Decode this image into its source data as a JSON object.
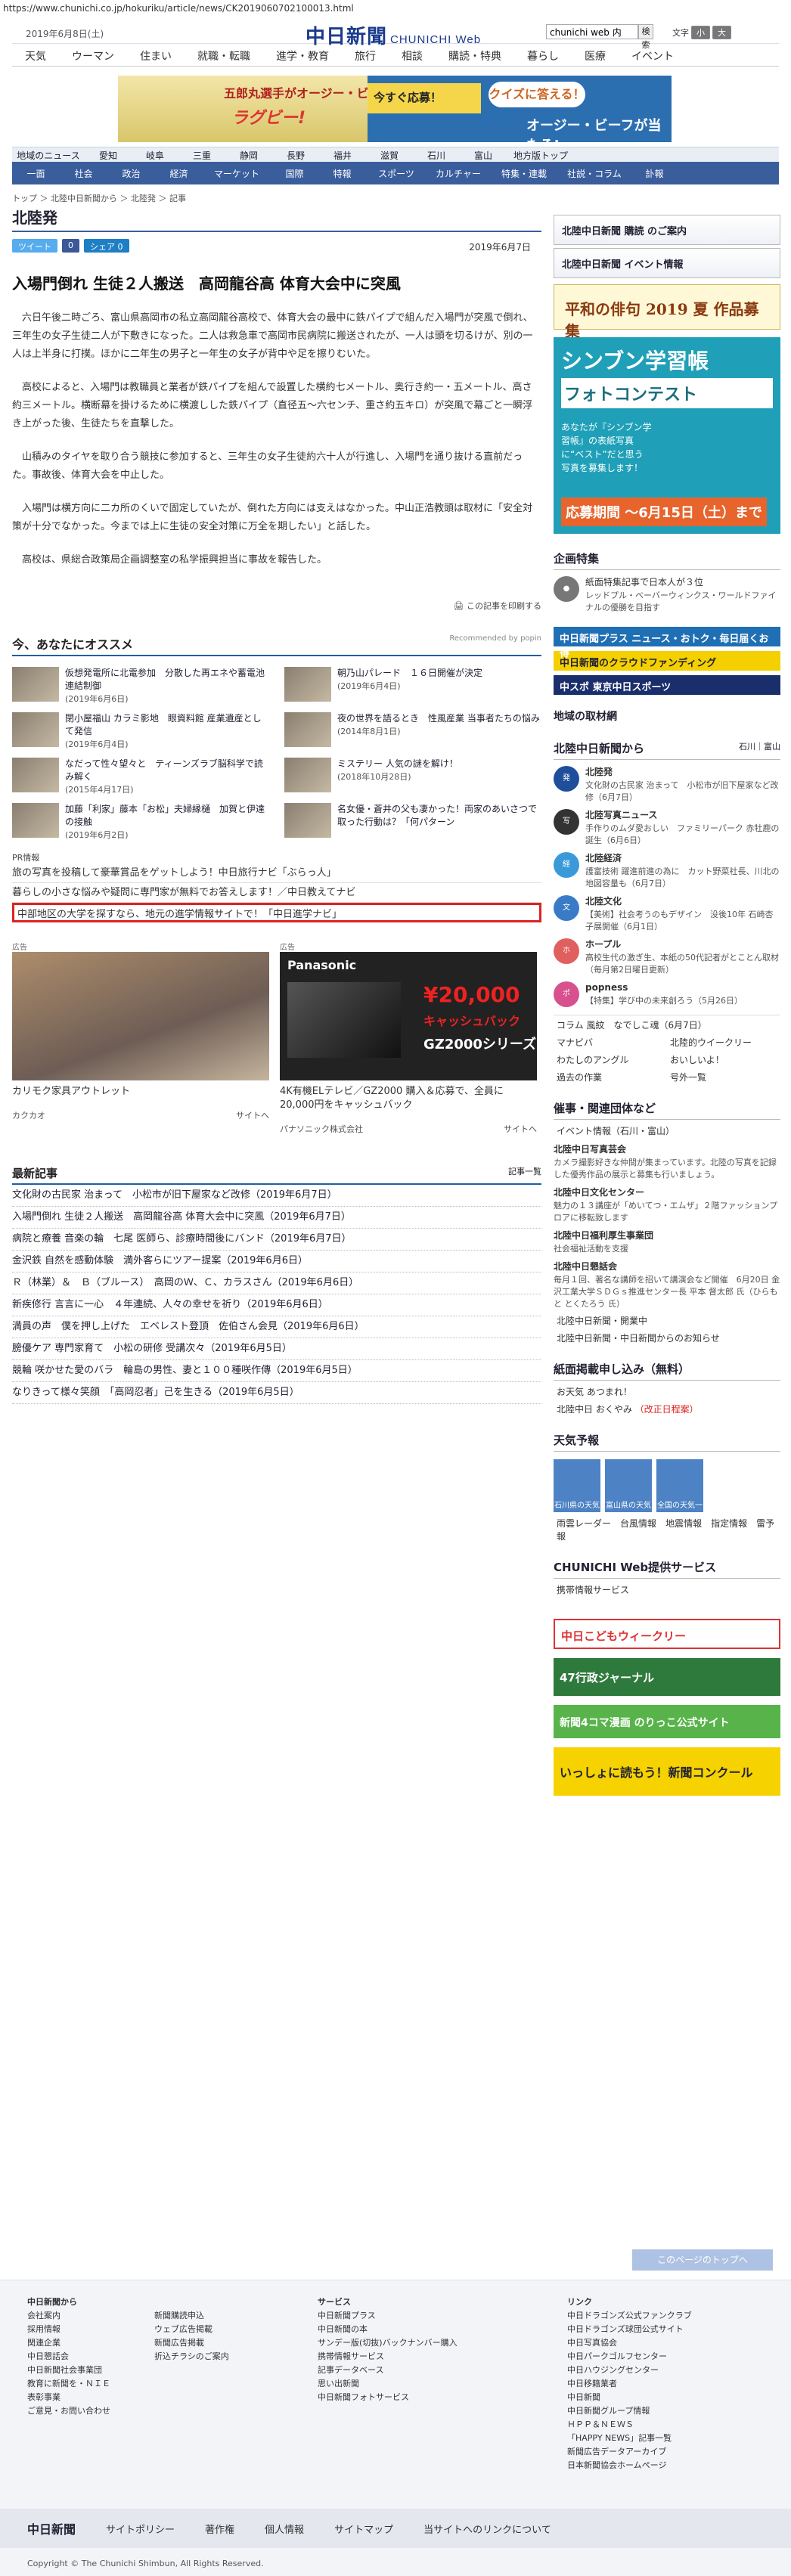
{
  "url": "https://www.chunichi.co.jp/hokuriku/article/news/CK2019060702100013.html",
  "header": {
    "date": "2019年6月8日(土)",
    "logo": "中日新聞",
    "logo_sub": "CHUNICHI Web",
    "search_value": "chunichi web 内",
    "search_btn": "検索",
    "font_label": "文字",
    "font_small": "小",
    "font_large": "大"
  },
  "nav1": [
    "天気",
    "ウーマン",
    "住まい",
    "就職・転職",
    "進学・教育",
    "旅行",
    "相談",
    "購読・特典",
    "暮らし",
    "医療",
    "イベント"
  ],
  "ad_top": {
    "t1": "五郎丸選手がオージー・ビーフ",
    "t2": "ラグビー!",
    "bubble": "クイズに答える！",
    "r1": "今すぐ応募！",
    "r2": "オージー・ビーフが当たる!"
  },
  "nav2": [
    "地域のニュース",
    "愛知",
    "岐阜",
    "三重",
    "静岡",
    "長野",
    "福井",
    "滋賀",
    "石川",
    "富山",
    "地方版トップ"
  ],
  "nav3": [
    "一面",
    "社会",
    "政治",
    "経済",
    "マーケット",
    "国際",
    "特報",
    "スポーツ",
    "カルチャー",
    "特集・連載",
    "社説・コラム",
    "訃報"
  ],
  "breadcrumb": "トップ ＞ 北陸中日新聞から ＞ 北陸発 ＞ 記事",
  "article": {
    "section": "北陸発",
    "share_tweet": "ツイート",
    "share_fb": "0",
    "share_hb": "シェア 0",
    "pub_date": "2019年6月7日",
    "headline": "入場門倒れ 生徒２人搬送　高岡龍谷高 体育大会中に突風",
    "paragraphs": [
      "六日午後二時ごろ、富山県高岡市の私立高岡龍谷高校で、体育大会の最中に鉄パイプで組んだ入場門が突風で倒れ、三年生の女子生徒二人が下敷きになった。二人は救急車で高岡市民病院に搬送されたが、一人は頭を切るけが、別の一人は上半身に打撲。ほかに二年生の男子と一年生の女子が背中や足を擦りむいた。",
      "高校によると、入場門は教職員と業者が鉄パイプを組んで設置した横約七メートル、奥行き約一・五メートル、高さ約三メートル。横断幕を掛けるために横渡しした鉄パイプ（直径五〜六センチ、重さ約五キロ）が突風で幕ごと一瞬浮き上がった後、生徒たちを直撃した。",
      "山積みのタイヤを取り合う競技に参加すると、三年生の女子生徒約六十人が行進し、入場門を通り抜ける直前だった。事故後、体育大会を中止した。",
      "入場門は横方向に二カ所のくいで固定していたが、倒れた方向には支えはなかった。中山正浩教頭は取材に「安全対策が十分でなかった。今までは上に生徒の安全対策に万全を期したい」と話した。",
      "高校は、県総合政策局企画調整室の私学振興担当に事故を報告した。"
    ],
    "print_label": "この記事を印刷する"
  },
  "recommend": {
    "title": "今、あなたにオススメ",
    "popin": "Recommended by popin",
    "items": [
      {
        "t": "仮想発電所に北電参加　分散した再エネや蓄電池連結制御",
        "d": "(2019年6月6日)"
      },
      {
        "t": "朝乃山パレード　１６日開催が決定",
        "d": "(2019年6月4日)"
      },
      {
        "t": "閉小屋福山 カラミ影地　眼資料館 産業遺産として発信",
        "d": "(2019年6月4日)"
      },
      {
        "t": "夜の世界を語るとき　性風産業 当事者たちの悩み",
        "d": "(2014年8月1日)"
      },
      {
        "t": "なだって性々望々と　ティーンズラブ脳科学で読み解く",
        "d": "(2015年4月17日)"
      },
      {
        "t": "ミステリー 人気の謎を解け！",
        "d": "(2018年10月28日)"
      },
      {
        "t": "加藤「利家」藤本「お松」夫婦縁樋　加賀と伊達の接触",
        "d": "(2019年6月2日)"
      },
      {
        "t": "名女優・蒼井の父も凄かった！両家のあいさつで取った行動は？「何パターン",
        "d": ""
      }
    ]
  },
  "pr": {
    "label": "PR情報",
    "items": [
      "旅の写真を投稿して豪華賞品をゲットしよう！中日旅行ナビ「ぶらっ人」",
      "暮らしの小さな悩みや疑問に専門家が無料でお答えします！／中日教えてナビ",
      "中部地区の大学を探すなら、地元の進学情報サイトで！「中日進学ナビ」"
    ]
  },
  "ads": [
    {
      "label": "広告",
      "caption": "カリモク家具アウトレット",
      "src": "カクカオ",
      "site": "サイトへ"
    },
    {
      "label": "広告",
      "brand": "Panasonic",
      "price": "¥20,000",
      "cashback": "キャッシュバック",
      "model": "GZ2000シリーズ",
      "caption": "4K有機ELテレビ／GZ2000 購入＆応募で、全員に20,000円をキャッシュバック",
      "src": "パナソニック株式会社",
      "site": "サイトへ"
    }
  ],
  "latest": {
    "title": "最新記事",
    "more": "記事一覧",
    "items": [
      "文化財の古民家 治まって　小松市が旧下屋家など改修（2019年6月7日）",
      "入場門倒れ 生徒２人搬送　高岡龍谷高 体育大会中に突風（2019年6月7日）",
      "病院と療養 音楽の輪　七尾 医師ら、診療時間後にバンド（2019年6月7日）",
      "金沢鉄 自然を感動体験　満外客らにツアー提案（2019年6月6日）",
      "Ｒ（林業）＆　Ｂ（ブルース）　高岡のＷ、Ｃ、カラスさん（2019年6月6日）",
      "新疾修行 言言に一心　４年連続、人々の幸せを祈り（2019年6月6日）",
      "満員の声　僕を押し上げた　エベレスト登頂　佐伯さん会見（2019年6月6日）",
      "膀優ケア 専門家育て　小松の研修 受講次々（2019年6月5日）",
      "競輪 咲かせた愛のバラ　輪島の男性、妻と１００種咲作傳（2019年6月5日）",
      "なりきって様々笑顔　「高岡忍者」己を生きる（2019年6月5日）"
    ]
  },
  "side": {
    "btn1": "北陸中日新聞 購読 のご案内",
    "btn2": "北陸中日新聞 イベント情報",
    "haiku": "平和の俳句 2019 夏 作品募集",
    "contest": {
      "h": "シンブン学習帳",
      "p": "フォトコンテスト",
      "q": "あなたが『シンブン学習帳』の表紙写真に“ベスト”だと思う写真を募集します！",
      "e": "応募期間 〜6月15日（土）まで"
    },
    "corp_title": "企画特集",
    "corp_items": [
      {
        "t": "紙面特集記事で日本人が３位",
        "n": "レッドプル・ベーバーウィンクス・ワールドファイナルの優勝を目指す"
      }
    ],
    "bar1": "中日新聞プラス ニュース・おトク・毎日届くお得",
    "bar2": "中日新聞のクラウドファンディング",
    "bar3": "中スポ 東京中日スポーツ",
    "region": "地域の取材網",
    "from_title": "北陸中日新聞から",
    "from_tabs": "石川｜富山",
    "from_items": [
      {
        "i": "発",
        "t": "北陸発",
        "n": "文化財の古民家 治まって　小松市が旧下屋家など改修（6月7日）"
      },
      {
        "i": "写",
        "t": "北陸写真ニュース",
        "n": "手作りのムダ愛おしい　ファミリーパーク 赤牡鹿の誕生（6月6日）"
      },
      {
        "i": "経",
        "t": "北陸経済",
        "n": "護富技術 躍進前進の為に　カット野菜社長、川北の地図容量も（6月7日）"
      },
      {
        "i": "文",
        "t": "北陸文化",
        "n": "【美術】社会考うのもデザイン　没後10年 石崎杏子展開催（6月1日）"
      },
      {
        "i": "ホ",
        "t": "ホープル",
        "n": "高校生代の激ぎ生、本紙の50代記者がとことん取材（毎月第2日曜日更新）"
      },
      {
        "i": "ポ",
        "t": "popness",
        "n": "【特集】学び中の未来創ろう（5月26日）"
      }
    ],
    "column": "コラム 風紋　なでしこ魂（6月7日）",
    "link_pairs": [
      [
        "マナビバ",
        "北陸的ウイークリー"
      ],
      [
        "わたしのアングル",
        "おいしいよ！"
      ],
      [
        "過去の作業",
        "号外一覧"
      ]
    ],
    "event_title": "催事・関連団体など",
    "event_sub": "イベント情報（石川・富山）",
    "events": [
      {
        "t": "北陸中日写真芸会",
        "n": "カメラ撮影好きな仲間が集まっています。北陸の写真を記録した優秀作品の展示と募集も行いましょう。"
      },
      {
        "t": "北陸中日文化センター",
        "n": "魅力の１３講座が「めいてつ・エムザ」２階ファッションプロアに移転致します"
      },
      {
        "t": "北陸中日福利厚生事業団",
        "n": "社会福祉活動を支援"
      },
      {
        "t": "北陸中日懇話会",
        "n": "毎月１回、著名な講師を招いて講演会など開催　6月20日 金沢工業大学ＳＤＧｓ推進センター長 平本 督太郎 氏（ひらもと とくたろう 氏）"
      }
    ],
    "ev_links": [
      "北陸中日新聞・開業中",
      "北陸中日新聞・中日新聞からのお知らせ"
    ],
    "notice_title": "紙面掲載申し込み（無料）",
    "notices": [
      "お天気 あつまれ！",
      "北陸中日 おくやみ"
    ],
    "notice_tag": "（改正日程案）",
    "weather_title": "天気予報",
    "weather": [
      "石川県の天気",
      "富山県の天気",
      "全国の天気一覧"
    ],
    "weather_links": [
      "雨雲レーダー",
      "台風情報",
      "地震情報",
      "指定情報",
      "雷予報"
    ],
    "svc_title": "CHUNICHI Web提供サービス",
    "svc_link": "携帯情報サービス",
    "banners": [
      "中日こどもウィークリー",
      "47行政ジャーナル",
      "新聞4コマ漫画 のりっこ公式サイト",
      "いっしょに読もう！新聞コンクール"
    ]
  },
  "to_top": "このページのトップへ",
  "footer": {
    "col1_title": "中日新聞から",
    "col1": [
      "会社案内",
      "採用情報",
      "関連企業",
      "中日懇話会",
      "中日新聞社会事業団",
      "教育に新聞を・ＮＩＥ",
      "表彰事業",
      "ご意見・お問い合わせ"
    ],
    "col1b": [
      "新聞購読申込",
      "ウェブ広告掲載",
      "新聞広告掲載",
      "折込チラシのご案内"
    ],
    "col2_title": "サービス",
    "col2": [
      "中日新聞プラス",
      "中日新聞の本",
      "サンデー版(切抜)バックナンバー購入",
      "携帯情報サービス",
      "記事データベース",
      "思い出新聞",
      "中日新聞フォトサービス"
    ],
    "col3_title": "リンク",
    "col3": [
      "中日ドラゴンズ公式ファンクラブ",
      "中日ドラゴンズ球団公式サイト",
      "中日写真協会",
      "中日パークゴルフセンター",
      "中日ハウジングセンター",
      "中日移籍業者",
      "中日新聞",
      "中日新聞グループ情報",
      "ＨＰＰ＆ＮＥＷＳ",
      "「HAPPY NEWS」記事一覧",
      "新聞広告データアーカイブ",
      "日本新聞協会ホームページ"
    ],
    "bar": [
      "中日新聞",
      "サイトポリシー",
      "著作権",
      "個人情報",
      "サイトマップ",
      "当サイトへのリンクについて"
    ],
    "copyright": "Copyright © The Chunichi Shimbun, All Rights Reserved."
  }
}
